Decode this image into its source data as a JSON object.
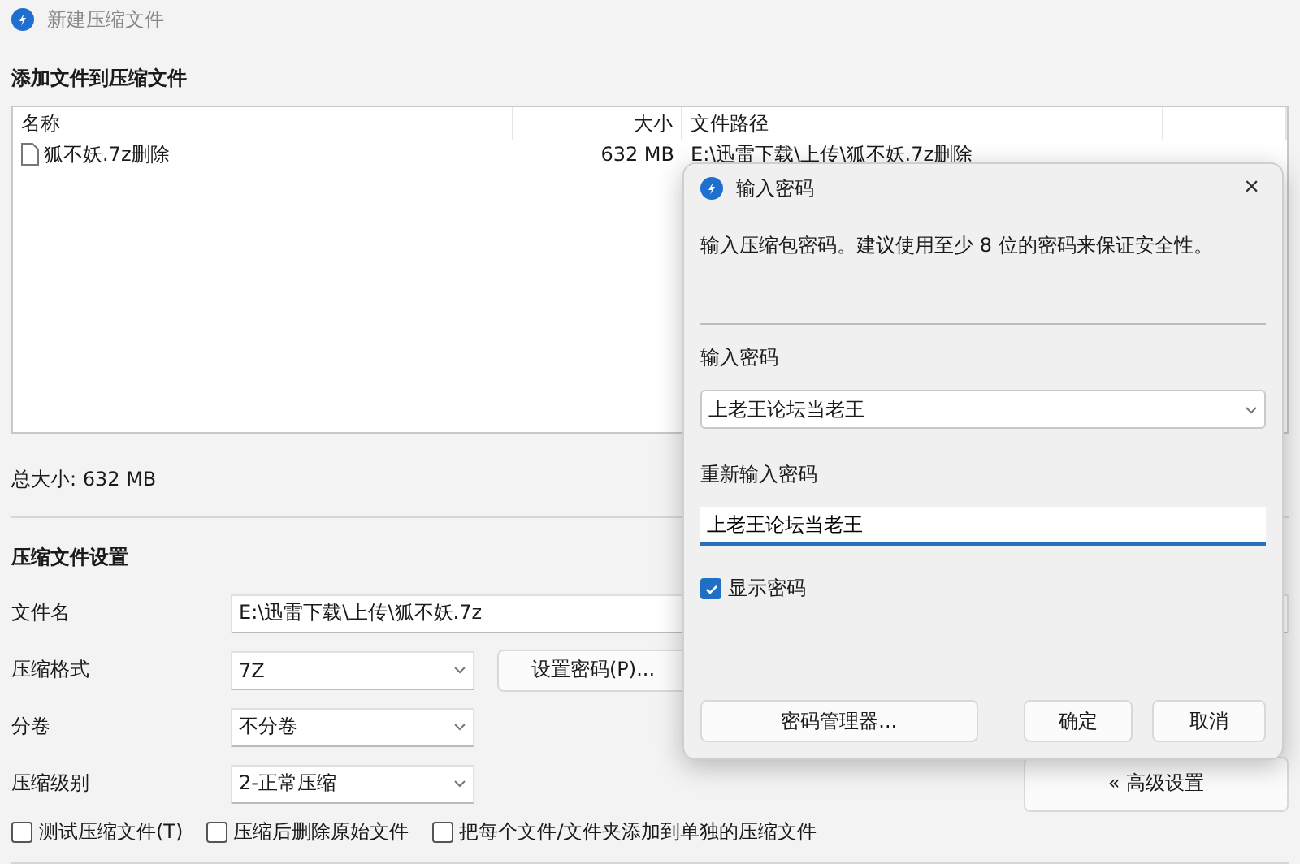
{
  "window": {
    "title": "新建压缩文件"
  },
  "add_section": {
    "heading": "添加文件到压缩文件"
  },
  "file_list": {
    "columns": [
      "名称",
      "大小",
      "文件路径"
    ],
    "rows": [
      {
        "name": "狐不妖.7z删除",
        "size": "632 MB",
        "path": "E:\\迅雷下载\\上传\\狐不妖.7z删除"
      }
    ]
  },
  "total_size": "总大小: 632 MB",
  "settings": {
    "heading": "压缩文件设置",
    "file_name": {
      "label": "文件名",
      "value": "E:\\迅雷下载\\上传\\狐不妖.7z"
    },
    "format": {
      "label": "压缩格式",
      "value": "7Z"
    },
    "set_password_button": "设置密码(P)...",
    "split": {
      "label": "分卷",
      "value": "不分卷"
    },
    "level": {
      "label": "压缩级别",
      "value": "2-正常压缩"
    },
    "options": [
      {
        "label": "测试压缩文件(T)",
        "checked": false
      },
      {
        "label": "压缩后删除原始文件",
        "checked": false
      },
      {
        "label": "把每个文件/文件夹添加到单独的压缩文件",
        "checked": false
      }
    ],
    "advanced_button": "« 高级设置"
  },
  "dialog": {
    "title": "输入密码",
    "close": "×",
    "message": "输入压缩包密码。建议使用至少 8 位的密码来保证安全性。",
    "password_label": "输入密码",
    "password_value": "上老王论坛当老王",
    "confirm_label": "重新输入密码",
    "confirm_value": "上老王论坛当老王",
    "show_password": {
      "label": "显示密码",
      "checked": true
    },
    "buttons": [
      "密码管理器...",
      "确定",
      "取消"
    ]
  }
}
